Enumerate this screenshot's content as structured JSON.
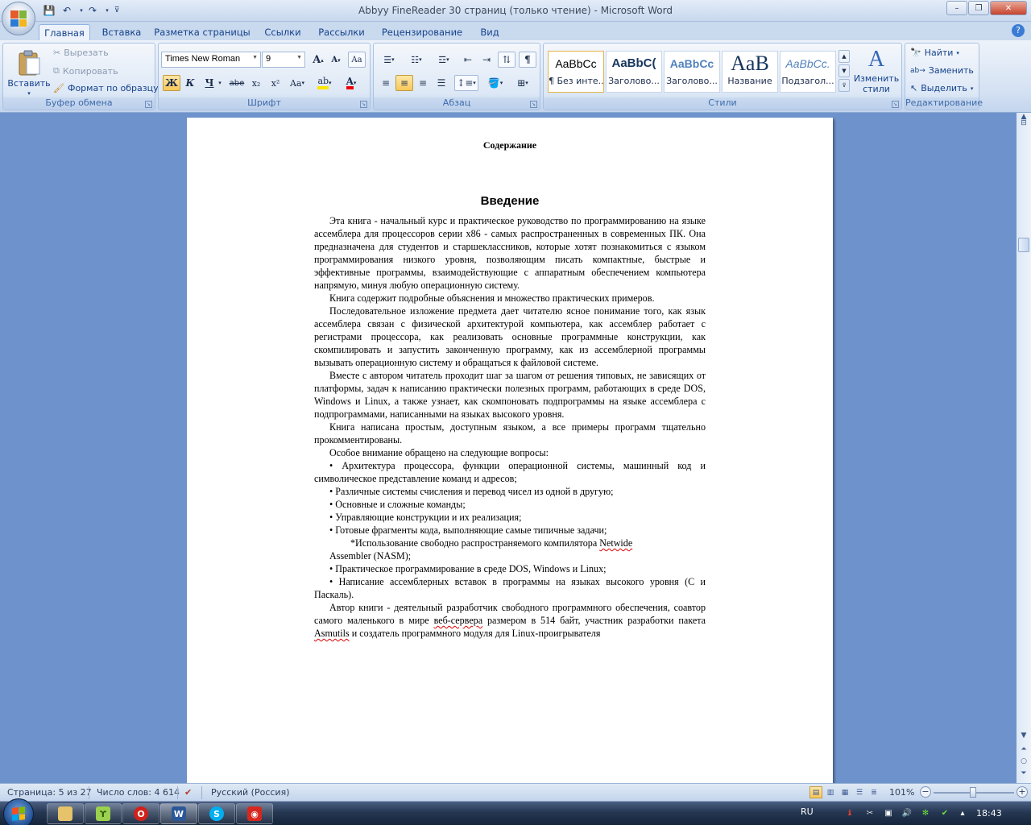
{
  "window": {
    "title": "Abbyy FineReader 30 страниц (только чтение) - Microsoft Word",
    "minimize": "–",
    "maximize": "❐",
    "close": "✕"
  },
  "tabs": [
    "Главная",
    "Вставка",
    "Разметка страницы",
    "Ссылки",
    "Рассылки",
    "Рецензирование",
    "Вид"
  ],
  "ribbon": {
    "clipboard": {
      "paste": "Вставить",
      "cut": "Вырезать",
      "copy": "Копировать",
      "format_painter": "Формат по образцу",
      "label": "Буфер обмена"
    },
    "font": {
      "name": "Times New Roman",
      "size": "9",
      "label": "Шрифт",
      "bold": "Ж",
      "italic": "К",
      "underline": "Ч",
      "strike": "abe",
      "subscript": "x₂",
      "superscript": "x²",
      "case": "Aa",
      "grow": "A",
      "shrink": "A",
      "clear": "Aa"
    },
    "paragraph": {
      "label": "Абзац"
    },
    "styles": {
      "label": "Стили",
      "items": [
        {
          "preview": "AaBbCc",
          "name": "¶ Без инте..."
        },
        {
          "preview": "AaBbC(",
          "name": "Заголово..."
        },
        {
          "preview": "AaBbCc",
          "name": "Заголово..."
        },
        {
          "preview": "AaB",
          "name": "Название"
        },
        {
          "preview": "AaBbCc.",
          "name": "Подзагол..."
        }
      ],
      "change": "Изменить стили"
    },
    "editing": {
      "label": "Редактирование",
      "find": "Найти",
      "replace": "Заменить",
      "select": "Выделить"
    }
  },
  "document": {
    "toc_title": "Содержание",
    "heading": "Введение",
    "paragraphs": [
      "Эта книга - начальный курс и практическое руководство по программированию на языке ассемблера для процессоров серии x86 - самых распространенных в современных ПК. Она предназначена для студентов и старшеклассников, которые хотят познакомиться с языком программирования низкого уровня, позволяющим писать компактные, быстрые и эффективные программы, взаимодействующие с аппаратным обеспечением компьютера напрямую, минуя любую операционную систему.",
      "Книга содержит подробные объяснения и множество практических примеров.",
      "Последовательное изложение предмета дает читателю ясное понимание того, как язык ассемблера связан с физической архитектурой компьютера, как ассемблер работает с регистрами процессора, как реализовать основные программные конструкции, как скомпилировать и запустить законченную программу, как из ассемблерной программы вызывать операционную систему и обращаться к файловой системе.",
      "Вместе с автором читатель проходит шаг за шагом от решения типовых, не зависящих от платформы, задач к написанию практически полезных программ, работающих в среде DOS, Windows и Linux, а также узнает, как скомпоновать подпрограммы на языке ассемблера с подпрограммами, написанными на языках высокого уровня.",
      "Книга написана простым, доступным языком, а все примеры программ тщательно прокомментированы.",
      "Особое внимание обращено на следующие вопросы:",
      "• Архитектура процессора, функции операционной системы, машинный код и символическое представление команд и адресов;",
      "• Различные системы счисления и перевод чисел из одной в другую;",
      "• Основные и сложные команды;",
      "• Управляющие конструкции и их реализация;",
      "• Готовые фрагменты кода, выполняющие самые типичные задачи;"
    ],
    "nasm_line_1_before": "*Использование свободно распространяемого компилятора ",
    "nasm_line_1_word": "Netwide",
    "nasm_line_2": "Assembler (NASM);",
    "bullets_after": [
      "• Практическое программирование в среде DOS, Windows и Linux;",
      "• Написание ассемблерных вставок в программы на языках высокого уровня (С и Паскаль)."
    ],
    "last_para": {
      "p1": "Автор книги - деятельный разработчик свободного программного обеспечения, соавтор самого маленького в мире ",
      "w1": "веб-сервера",
      "p2": " размером в 514 байт, участник разработки пакета ",
      "w2": "Asmutils",
      "p3": " и создатель программного модуля для Linux-проигрывателя"
    }
  },
  "statusbar": {
    "page": "Страница: 5 из 27",
    "words": "Число слов: 4 614",
    "language": "Русский (Россия)",
    "zoom": "101%",
    "zoom_minus": "−",
    "zoom_plus": "+"
  },
  "taskbar": {
    "lang": "RU",
    "clock": "18:43"
  },
  "colors": {
    "ribbon_bg": "#d5e2f3",
    "workspace": "#6e93cc",
    "accent_text": "#15428b"
  }
}
